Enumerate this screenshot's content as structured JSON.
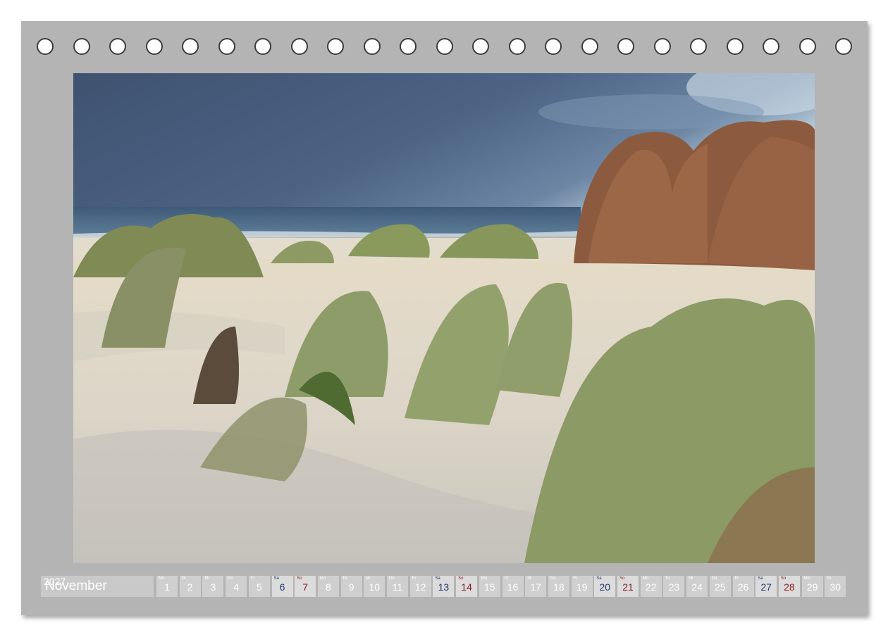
{
  "calendar": {
    "month": "November",
    "year": "2027",
    "days": [
      {
        "wd": "Mo",
        "d": "1",
        "type": "weekday"
      },
      {
        "wd": "Di",
        "d": "2",
        "type": "weekday"
      },
      {
        "wd": "Mi",
        "d": "3",
        "type": "weekday"
      },
      {
        "wd": "Do",
        "d": "4",
        "type": "weekday"
      },
      {
        "wd": "Fr",
        "d": "5",
        "type": "weekday"
      },
      {
        "wd": "Sa",
        "d": "6",
        "type": "sat"
      },
      {
        "wd": "So",
        "d": "7",
        "type": "sun"
      },
      {
        "wd": "Mo",
        "d": "8",
        "type": "weekday"
      },
      {
        "wd": "Di",
        "d": "9",
        "type": "weekday"
      },
      {
        "wd": "Mi",
        "d": "10",
        "type": "weekday"
      },
      {
        "wd": "Do",
        "d": "11",
        "type": "weekday"
      },
      {
        "wd": "Fr",
        "d": "12",
        "type": "weekday"
      },
      {
        "wd": "Sa",
        "d": "13",
        "type": "sat"
      },
      {
        "wd": "So",
        "d": "14",
        "type": "sun"
      },
      {
        "wd": "Mo",
        "d": "15",
        "type": "weekday"
      },
      {
        "wd": "Di",
        "d": "16",
        "type": "weekday"
      },
      {
        "wd": "Mi",
        "d": "17",
        "type": "weekday"
      },
      {
        "wd": "Do",
        "d": "18",
        "type": "weekday"
      },
      {
        "wd": "Fr",
        "d": "19",
        "type": "weekday"
      },
      {
        "wd": "Sa",
        "d": "20",
        "type": "sat"
      },
      {
        "wd": "So",
        "d": "21",
        "type": "sun"
      },
      {
        "wd": "Mo",
        "d": "22",
        "type": "weekday"
      },
      {
        "wd": "Di",
        "d": "23",
        "type": "weekday"
      },
      {
        "wd": "Mi",
        "d": "24",
        "type": "weekday"
      },
      {
        "wd": "Do",
        "d": "25",
        "type": "weekday"
      },
      {
        "wd": "Fr",
        "d": "26",
        "type": "weekday"
      },
      {
        "wd": "Sa",
        "d": "27",
        "type": "sat"
      },
      {
        "wd": "So",
        "d": "28",
        "type": "sun"
      },
      {
        "wd": "Mo",
        "d": "29",
        "type": "weekday"
      },
      {
        "wd": "Di",
        "d": "30",
        "type": "weekday"
      }
    ]
  },
  "colors": {
    "frame": "#b4b4b4",
    "saturday": "#1f3b6b",
    "sunday": "#8c1b1b"
  }
}
